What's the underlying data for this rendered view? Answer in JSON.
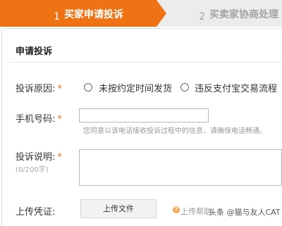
{
  "steps": [
    {
      "number": "1",
      "label": "买家申请投诉"
    },
    {
      "number": "2",
      "label": "买卖家协商处理"
    }
  ],
  "section_title": "申请投诉",
  "reason": {
    "label": "投诉原因:",
    "required_mark": "*",
    "options": [
      "未按约定时间发货",
      "违反支付宝交易流程"
    ]
  },
  "phone": {
    "label": "手机号码:",
    "required_mark": "*",
    "value": "",
    "hint": "您同意以该电话接收投诉过程中的信息，请确保电话畅通。"
  },
  "description": {
    "label": "投诉说明:",
    "required_mark": "*",
    "counter": "(0/200字)",
    "value": ""
  },
  "proof": {
    "label": "上传凭证:",
    "upload_button": "上传文件",
    "help_icon_text": "?",
    "help_text": "上传帮助"
  },
  "watermark": "头条 @猫与友人CAT",
  "colors": {
    "accent": "#ef7314",
    "inactive_step_bg": "#ececec"
  }
}
